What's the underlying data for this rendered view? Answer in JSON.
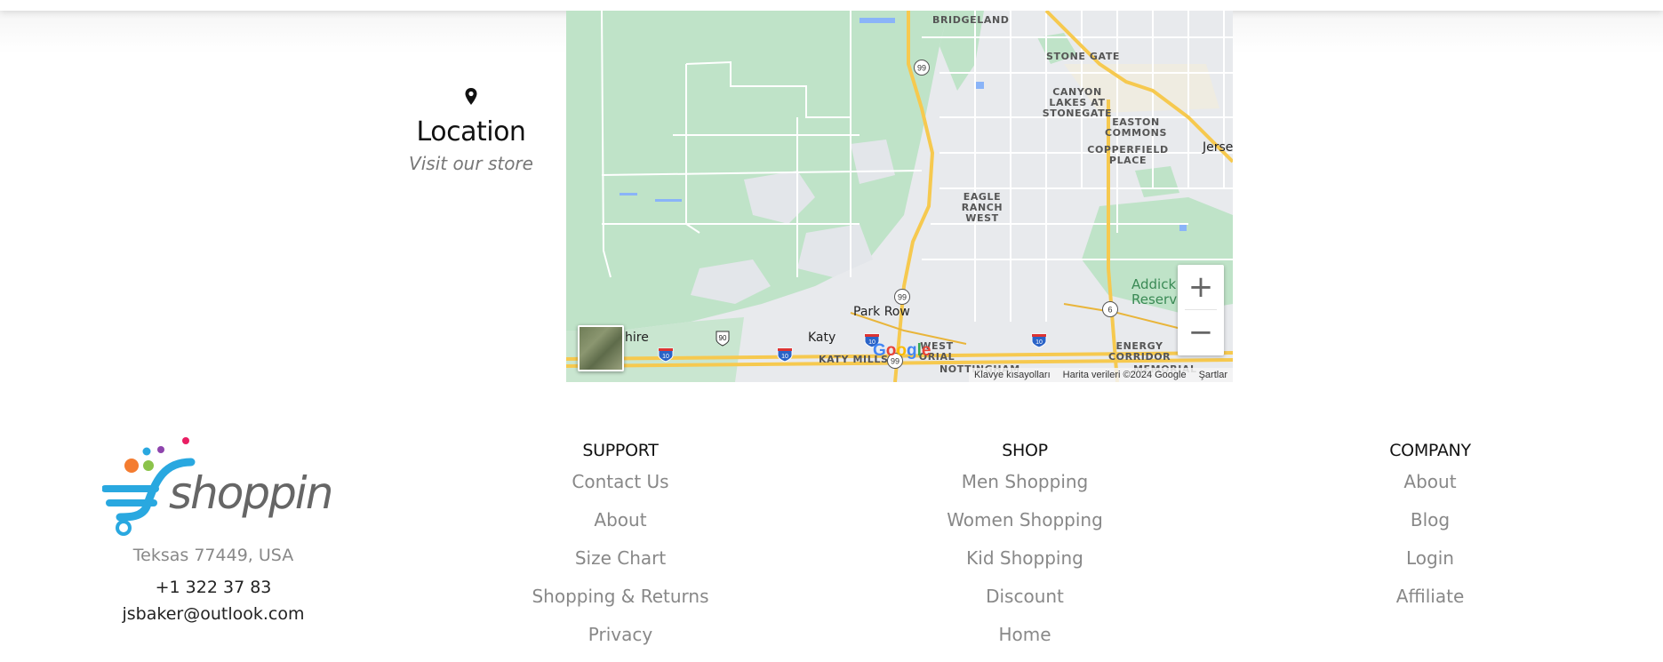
{
  "location": {
    "icon": "map-pin-icon",
    "title": "Location",
    "subtitle": "Visit our store"
  },
  "map": {
    "places": {
      "bridgeland": "BRIDGELAND",
      "stone_gate": "STONE GATE",
      "canyon_lakes": "CANYON LAKES AT STONEGATE",
      "easton_commons": "EASTON COMMONS",
      "copperfield_place": "COPPERFIELD PLACE",
      "jersey": "Jerse",
      "eagle_ranch_west": "EAGLE RANCH WEST",
      "addicks": "Addick Reserv",
      "park_row": "Park Row",
      "katy": "Katy",
      "hire": "hire",
      "katy_mills": "KATY MILLS",
      "west_orial": "WEST ORIAL",
      "energy_corridor": "ENERGY CORRIDOR",
      "nottingham": "NOTTINGHAM",
      "memorial": "MEMORIAL"
    },
    "shields": {
      "us99_top": "99",
      "us99_mid": "99",
      "us99_bottom": "99",
      "us90": "90",
      "hw6": "6",
      "i10": "10"
    },
    "zoom_in_label": "+",
    "zoom_out_label": "−",
    "google_logo": "Google",
    "attribution": {
      "shortcuts": "Klavye kısayolları",
      "data": "Harita verileri ©2024 Google",
      "terms": "Şartlar"
    },
    "colors": {
      "green": "#bfe3c8",
      "roads_major": "#f6c94f",
      "urban": "#e8eaed"
    }
  },
  "footer": {
    "brand": "shopping",
    "address": "Teksas 77449, USA",
    "phone": "+1 322 37 83",
    "email": "jsbaker@outlook.com",
    "support": {
      "heading": "SUPPORT",
      "links": [
        "Contact Us",
        "About",
        "Size Chart",
        "Shopping & Returns",
        "Privacy"
      ]
    },
    "shop": {
      "heading": "SHOP",
      "links": [
        "Men Shopping",
        "Women Shopping",
        "Kid Shopping",
        "Discount",
        "Home"
      ]
    },
    "company": {
      "heading": "COMPANY",
      "links": [
        "About",
        "Blog",
        "Login",
        "Affiliate"
      ]
    }
  }
}
